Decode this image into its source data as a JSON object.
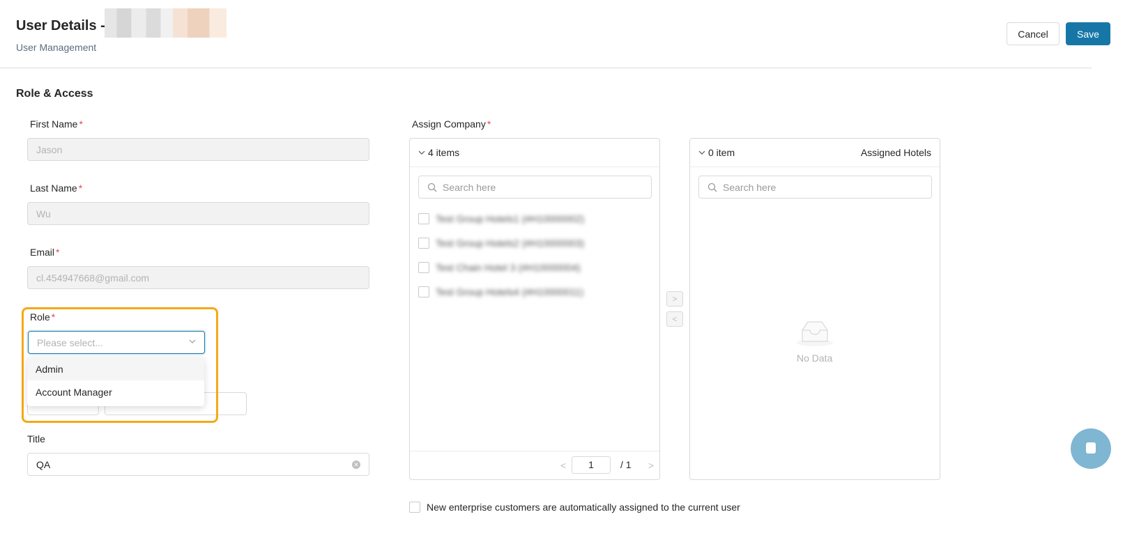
{
  "header": {
    "title": "User Details -",
    "breadcrumb": "User Management",
    "cancel_label": "Cancel",
    "save_label": "Save"
  },
  "section": {
    "title": "Role & Access"
  },
  "form": {
    "first_name": {
      "label": "First Name",
      "value": "Jason"
    },
    "last_name": {
      "label": "Last Name",
      "value": "Wu"
    },
    "email": {
      "label": "Email",
      "value": "cl.454947668@gmail.com"
    },
    "role": {
      "label": "Role",
      "placeholder": "Please select...",
      "options": [
        "Admin",
        "Account Manager"
      ]
    },
    "title": {
      "label": "Title",
      "value": "QA"
    },
    "required_mark": "*"
  },
  "assign_company": {
    "label": "Assign Company",
    "left": {
      "count": "4 items",
      "search_placeholder": "Search here",
      "items": [
        "Test Group Hotels1 (#H10000002)",
        "Test Group Hotels2 (#H10000003)",
        "Test Chain Hotel 3 (#H10000004)",
        "Test Group Hotels4 (#H10000011)"
      ],
      "page_current": "1",
      "page_total": "/ 1"
    },
    "right": {
      "count": "0 item",
      "title": "Assigned Hotels",
      "search_placeholder": "Search here",
      "empty_text": "No Data"
    },
    "move_right": ">",
    "move_left": "<",
    "pager_prev": "<",
    "pager_next": ">"
  },
  "auto_assign": {
    "label": "New enterprise customers are automatically assigned to the current user"
  },
  "colors": {
    "primary": "#1677a7",
    "highlight": "#f5a817",
    "required": "#e5484d"
  }
}
